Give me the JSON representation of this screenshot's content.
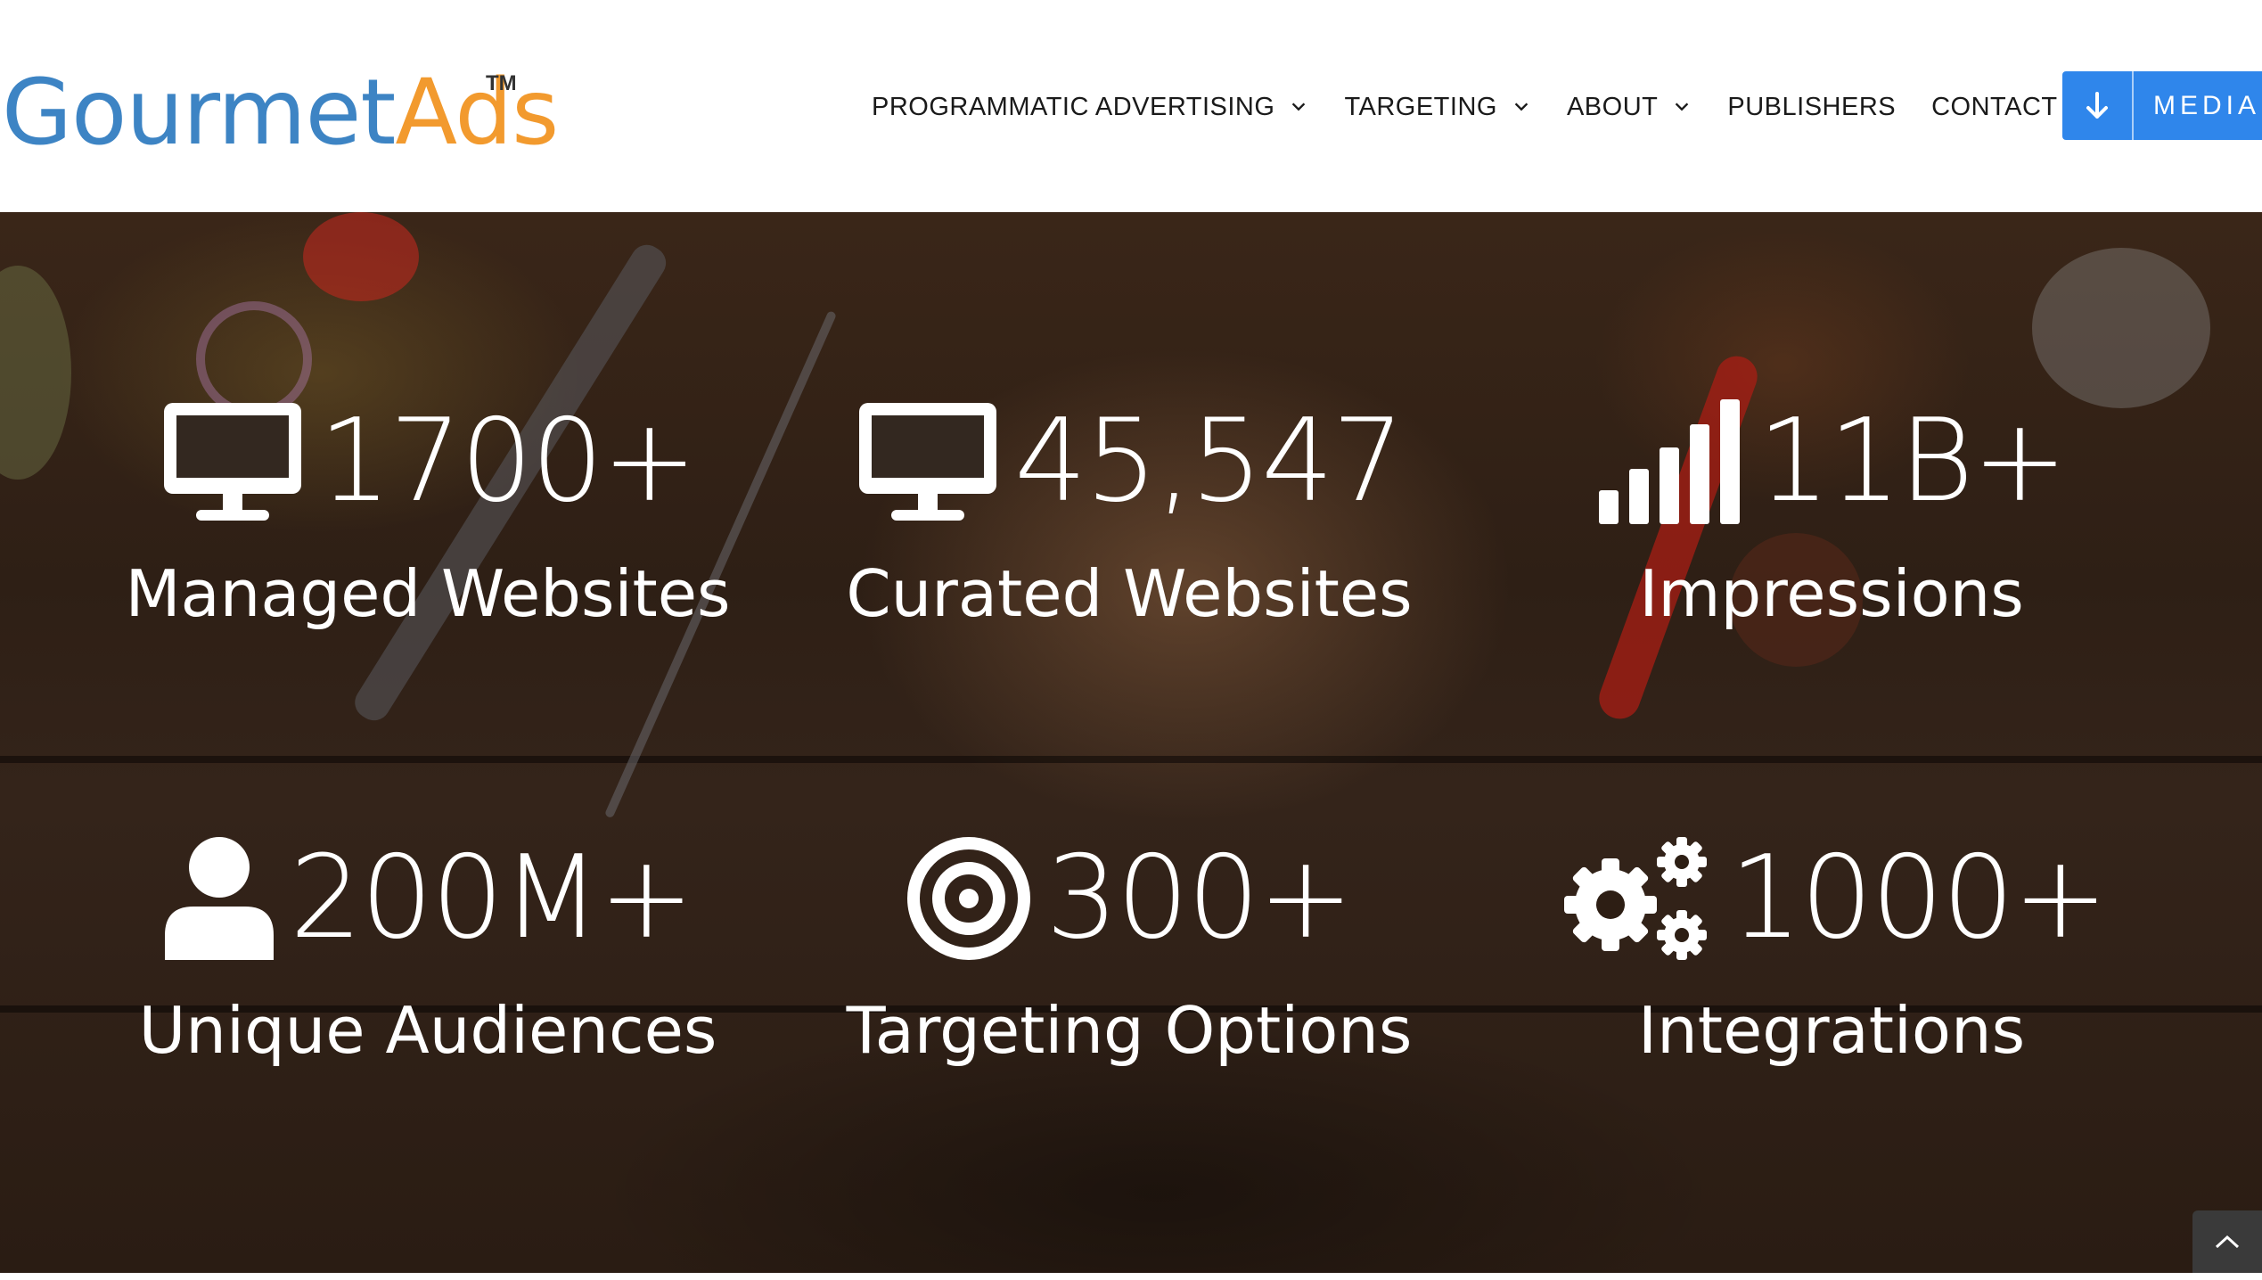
{
  "header": {
    "logo": {
      "part1": "Gourmet",
      "part2": "Ads",
      "tm": "TM"
    },
    "nav": [
      {
        "label": "PROGRAMMATIC ADVERTISING",
        "has_dropdown": true
      },
      {
        "label": "TARGETING",
        "has_dropdown": true
      },
      {
        "label": "ABOUT",
        "has_dropdown": true
      },
      {
        "label": "PUBLISHERS",
        "has_dropdown": false
      },
      {
        "label": "CONTACT",
        "has_dropdown": false
      }
    ],
    "cta": {
      "label": "MEDIA",
      "icon": "arrow-down-icon"
    }
  },
  "stats": [
    {
      "value": "1700+",
      "label": "Managed Websites",
      "icon": "desktop-icon"
    },
    {
      "value": "45,547",
      "label": "Curated Websites",
      "icon": "desktop-icon"
    },
    {
      "value": "11B+",
      "label": "Impressions",
      "icon": "signal-bars-icon"
    },
    {
      "value": "200M+",
      "label": "Unique Audiences",
      "icon": "user-icon"
    },
    {
      "value": "300+",
      "label": "Targeting Options",
      "icon": "target-icon"
    },
    {
      "value": "1000+",
      "label": "Integrations",
      "icon": "gears-icon"
    }
  ],
  "colors": {
    "logo_blue": "#3d84c4",
    "logo_orange": "#f29a2e",
    "cta_blue": "#2f86eb",
    "nav_text": "#1a1a1a",
    "stat_text": "#ffffff"
  }
}
